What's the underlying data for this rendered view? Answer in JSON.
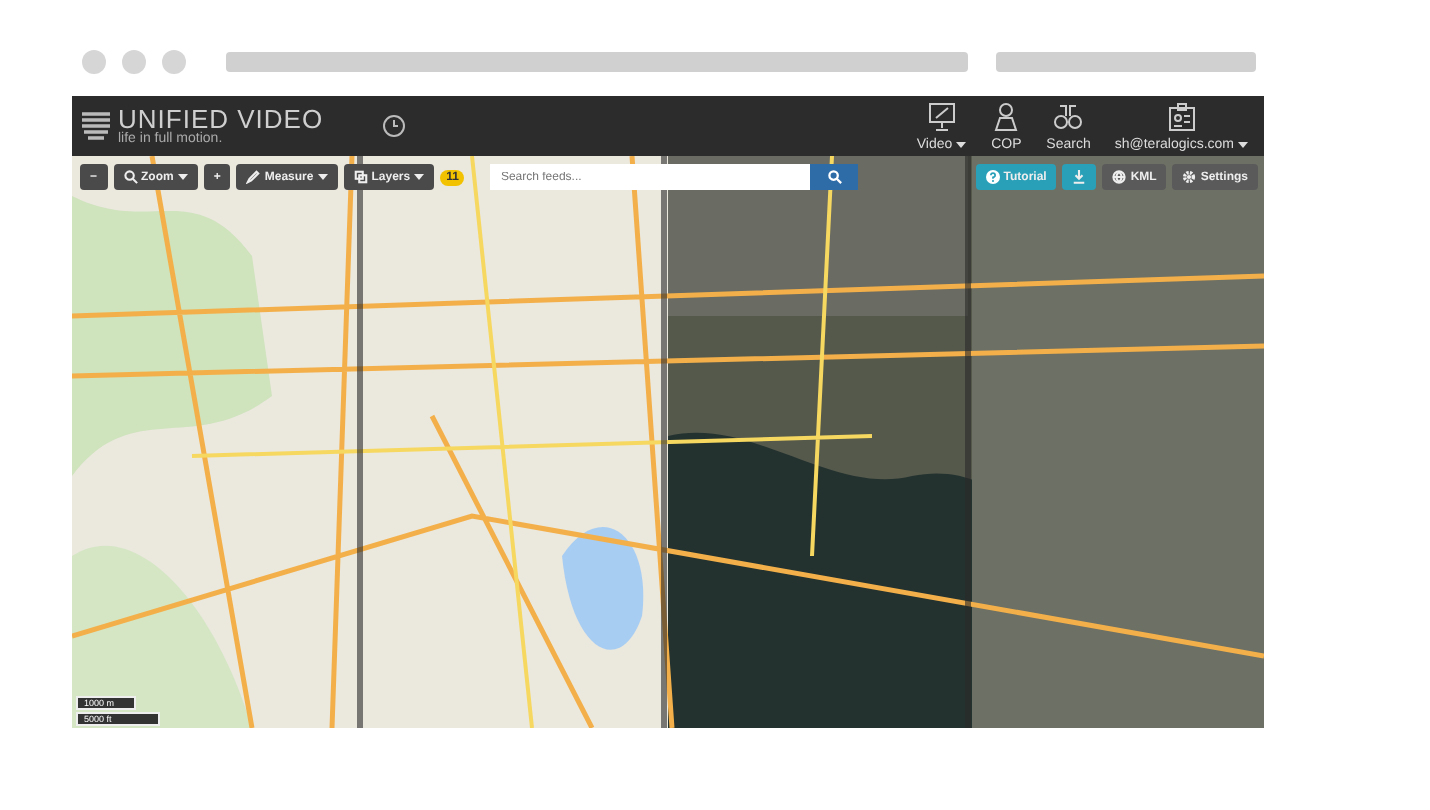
{
  "app": {
    "logo": {
      "title": "UNIFIED VIDEO",
      "tagline": "life in full motion."
    },
    "nav": [
      {
        "kind": "monitor",
        "label": "Video",
        "caret": true
      },
      {
        "kind": "pin",
        "label": "COP",
        "caret": false
      },
      {
        "kind": "binoculars",
        "label": "Search",
        "caret": false
      },
      {
        "kind": "badge",
        "label": "sh@teralogics.com",
        "caret": true
      }
    ]
  },
  "toolbar": {
    "controls": [
      {
        "kind": "minus",
        "label": "−",
        "caret": false
      },
      {
        "kind": "zoom",
        "label": "Zoom",
        "caret": true
      },
      {
        "kind": "plus",
        "label": "+",
        "caret": false
      },
      {
        "kind": "measure",
        "label": "Measure",
        "caret": true
      },
      {
        "kind": "layers",
        "label": "Layers",
        "caret": true
      }
    ],
    "layer_count": "11",
    "search": {
      "placeholder": "Search feeds..."
    },
    "actions": [
      {
        "kind": "tutorial",
        "label": "Tutorial",
        "color": "#2aa0b8"
      },
      {
        "kind": "download",
        "color": "#2aa0b8"
      },
      {
        "kind": "kml",
        "label": "KML",
        "color": "#5a5a5a"
      },
      {
        "kind": "settings",
        "label": "Settings",
        "color": "#5a5a5a"
      }
    ]
  },
  "scale": {
    "metric": "1000 m",
    "imperial": "5000 ft"
  }
}
